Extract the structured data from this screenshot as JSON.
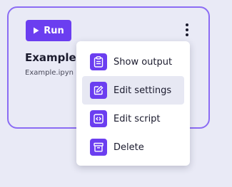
{
  "card": {
    "run_label": "Run",
    "title": "Example",
    "filename": "Example.ipyn"
  },
  "menu": {
    "items": [
      {
        "label": "Show output",
        "icon": "clipboard-icon",
        "active": false
      },
      {
        "label": "Edit settings",
        "icon": "edit-icon",
        "active": true
      },
      {
        "label": "Edit script",
        "icon": "code-icon",
        "active": false
      },
      {
        "label": "Delete",
        "icon": "archive-icon",
        "active": false
      }
    ]
  },
  "colors": {
    "accent": "#6b3ef0",
    "card_border": "#8b6cf4",
    "background": "#e9eaf6",
    "menu_hover": "#e7e8f3"
  }
}
